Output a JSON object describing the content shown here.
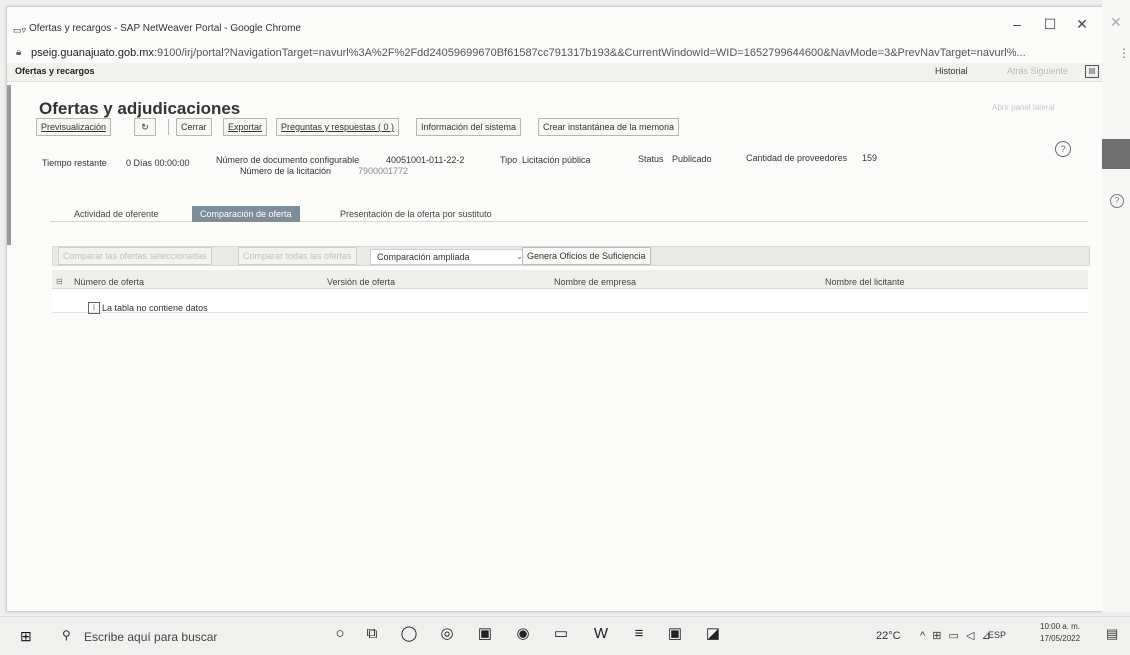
{
  "window": {
    "title": "Ofertas y recargos - SAP NetWeaver Portal - Google Chrome",
    "url_host": "pseig.guanajuato.gob.mx",
    "url_rest": ":9100/irj/portal?NavigationTarget=navurl%3A%2F%2Fdd24059699670Bf61587cc791317b193&&CurrentWindowId=WID=1652799644600&NavMode=3&PrevNavTarget=navurl%..."
  },
  "portal": {
    "header_title": "Ofertas y recargos",
    "history": "Historial",
    "back_forward": "Atrás Siguiente",
    "panel_link": "Abrir panel lateral"
  },
  "page": {
    "title": "Ofertas y adjudicaciones"
  },
  "toolbar": {
    "preview": "Previsualización",
    "refresh": "↻",
    "close": "Cerrar",
    "export": "Exportar",
    "qa": "Preguntas y respuestas ( 0 )",
    "sysinfo": "Información del sistema",
    "snapshot": "Crear instantánea de la memoria"
  },
  "info": {
    "remaining_label": "Tiempo restante",
    "remaining_value": "0 Días 00:00:00",
    "doc_label": "Número de documento configurable",
    "doc_value": "40051001-011-22-2",
    "tender_label": "Número de la licitación",
    "tender_value": "7900001772",
    "type_label": "Tipo",
    "type_value": "Licitación pública",
    "status_label": "Status",
    "status_value": "Publicado",
    "suppliers_label": "Cantidad de proveedores",
    "suppliers_value": "159"
  },
  "tabs": [
    {
      "label": "Actividad de oferente"
    },
    {
      "label": "Comparación de oferta"
    },
    {
      "label": "Presentación de la oferta por sustituto"
    }
  ],
  "table_toolbar": {
    "compare_selected": "Comparar las ofertas seleccionadas",
    "compare_all": "Comparar todas las ofertas",
    "view_select": "Comparación ampliada",
    "generate": "Genera Oficios de Suficiencia"
  },
  "table": {
    "columns": [
      "Número de oferta",
      "Versión de oferta",
      "Nombre de empresa",
      "Nombre del licitante"
    ],
    "empty_message": "La tabla no contiene datos"
  },
  "taskbar": {
    "search_placeholder": "Escribe aquí para buscar",
    "temperature": "22°C",
    "language": "ESP",
    "time": "10:00 a. m.",
    "date": "17/05/2022"
  }
}
